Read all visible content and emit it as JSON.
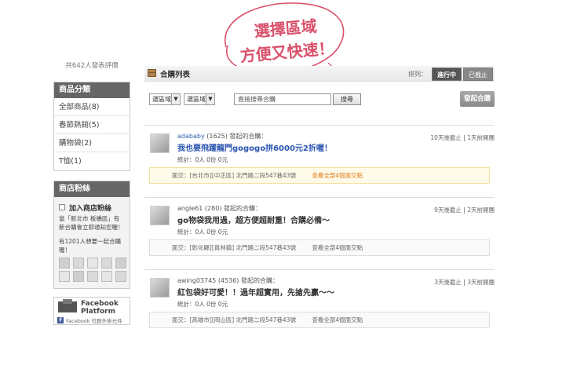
{
  "sidebar": {
    "review_count": "共642人發表評價",
    "categories": {
      "title": "商品分類",
      "items": [
        {
          "label": "全部商品(8)"
        },
        {
          "label": "春節熱銷(5)"
        },
        {
          "label": "購物袋(2)"
        },
        {
          "label": "T恤(1)"
        }
      ]
    },
    "fans": {
      "title": "商店粉絲",
      "join_label": "加入商店粉絲",
      "note": "當「新北市 板橋區」有新合購會立即通知您喔！",
      "count_text": "有1201人想要一起合購喔！"
    },
    "facebook": {
      "title": "Facebook Platform",
      "sub": "Facebook 社群外掛元件"
    }
  },
  "main": {
    "header": {
      "title": "合購列表",
      "sort_label": "排列：",
      "sort_active": "進行中",
      "sort_ended": "已截止"
    },
    "filters": {
      "select1": "選區域",
      "select2": "選區域",
      "search_value": "直接搜尋合購",
      "search_button": "搜尋",
      "start_button": "發起合購"
    },
    "posts": [
      {
        "user": "adababy",
        "score": "(1625)",
        "action": "發起的合購：",
        "title": "我也要飛躍龍門gogogo拼6000元2折喔！",
        "stats": "統計：0人 0份 0元",
        "time": "10天後截止 | 1天前開團",
        "location": "面交：[台北市][中正區] 北門路二段547巷43號",
        "more": "查看全部4個面交點"
      },
      {
        "user": "angle61",
        "score": "(280)",
        "action": "發起的合購：",
        "title": "go物袋我用過，超方便超耐重！合購必備～",
        "stats": "統計：0人 0份 0元",
        "time": "9天後截止 | 2天前開團",
        "location": "面交：[彰化縣][員林鎮] 北門路二段547巷43號",
        "more": "查看全部4個面交點"
      },
      {
        "user": "awing03745",
        "score": "(4536)",
        "action": "發起的合購：",
        "title": "紅包袋好可愛！！過年超實用，先搶先贏～～",
        "stats": "統計：0人 0份 0元",
        "time": "3天後截止 | 3天前開團",
        "location": "面交：[高雄市][岡山區] 北門路二段547巷43號",
        "more": "查看全部4個面交點"
      }
    ]
  },
  "banner": {
    "line1": "選擇區域",
    "line2": "方便又快速！",
    "color": "#d9506a"
  }
}
